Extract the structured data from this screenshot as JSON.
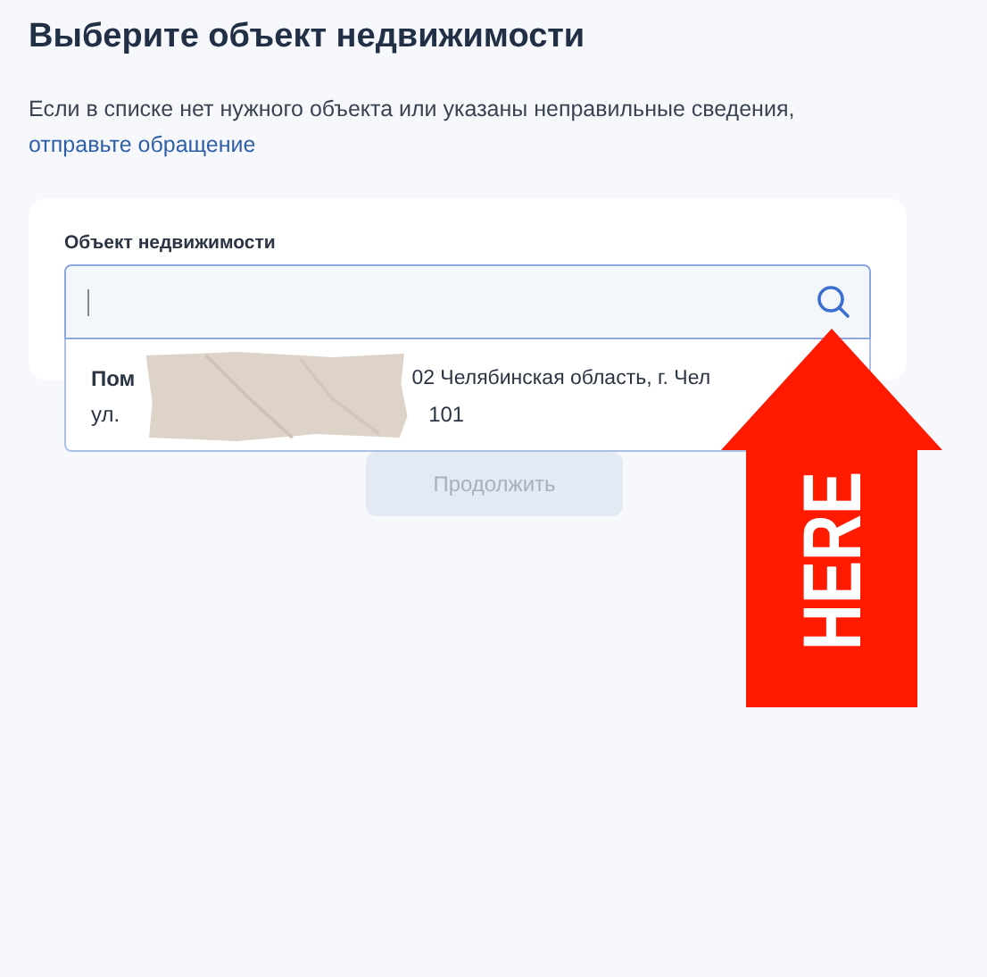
{
  "title": "Выберите объект недвижимости",
  "notice": {
    "text": "Если в списке нет нужного объекта или указаны неправильные сведения,",
    "link": "отправьте обращение"
  },
  "form": {
    "label": "Объект недвижимости",
    "search": {
      "focused": true
    },
    "suggestions": [
      {
        "line_1": {
          "start": "Пом",
          "end": "02 Челябинская область, г. Чел"
        },
        "line_2": {
          "start": "ул.",
          "end": "101"
        }
      }
    ]
  },
  "button": {
    "label": "Продолжить",
    "disabled": true
  },
  "overlays": [
    {
      "kind": "tape"
    },
    {
      "kind": "arrow",
      "label": "HERE"
    }
  ]
}
